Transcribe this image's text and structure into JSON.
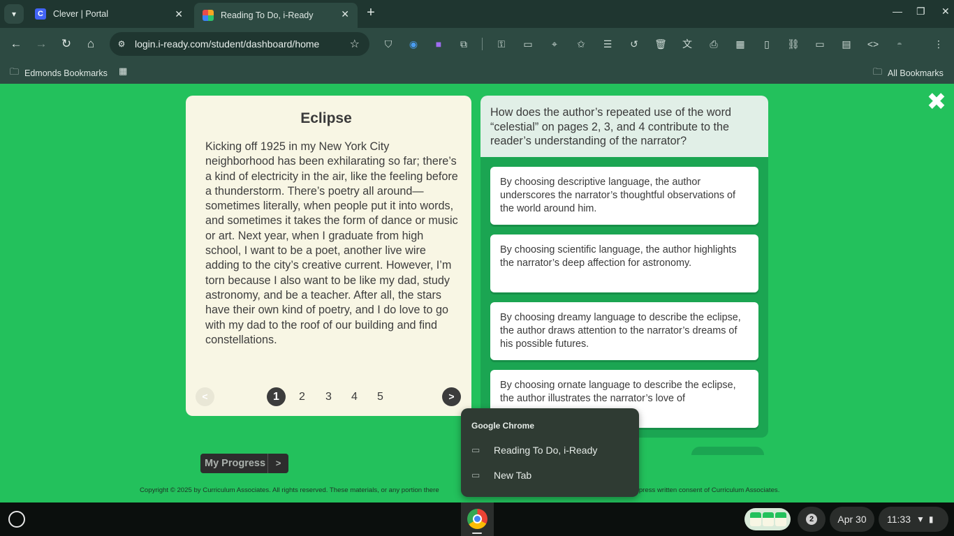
{
  "browser": {
    "tabs": [
      {
        "title": "Clever | Portal",
        "favicon": "clever-icon",
        "active": false
      },
      {
        "title": "Reading To Do, i-Ready",
        "favicon": "iready-icon",
        "active": true
      }
    ],
    "url": "login.i-ready.com/student/dashboard/home",
    "bookmarks": {
      "left": "Edmonds Bookmarks",
      "right": "All Bookmarks"
    }
  },
  "passage": {
    "title": "Eclipse",
    "text": "Kicking off 1925 in my New York City neighborhood has been exhilarating so far; there’s a kind of electricity in the air, like the feeling before a thunderstorm. There’s poetry all around—sometimes literally, when people put it into words, and sometimes it takes the form of dance or music or art. Next year, when I graduate from high school, I want to be a poet, another live wire adding to the city’s creative current. However, I’m torn because I also want to be like my dad, study astronomy, and be a teacher. After all, the stars have their own kind of poetry, and I do love to go with my dad to the roof of our building and find constellations.",
    "pages": [
      "1",
      "2",
      "3",
      "4",
      "5"
    ],
    "current_page": "1",
    "prev_label": "<",
    "next_label": ">"
  },
  "question": {
    "text": "How does the author’s repeated use of the word “celestial” on pages 2, 3, and 4 contribute to the reader’s understanding of the narrator?",
    "choices": [
      "By choosing descriptive language, the author underscores the narrator’s thoughtful observations of the world around him.",
      "By choosing scientific language, the author highlights the narrator’s deep affection for astronomy.",
      "By choosing dreamy language to describe the eclipse, the author draws attention to the narrator’s dreams of his possible futures.",
      "By choosing ornate language to describe the eclipse, the author illustrates the narrator’s love of"
    ]
  },
  "progress_button": {
    "label": "My Progress",
    "arrow": ">"
  },
  "copyright": "Copyright © 2025 by Curriculum Associates. All rights reserved. These materials, or any portion there",
  "copyright_tail": "thout express written consent of Curriculum Associates.",
  "popup": {
    "title": "Google Chrome",
    "items": [
      "Reading To Do, i-Ready",
      "New Tab"
    ]
  },
  "shelf": {
    "notification_count": "2",
    "date": "Apr 30",
    "time": "11:33"
  },
  "colors": {
    "page_bg": "#23c15c",
    "panel_green": "#1ba552",
    "passage_bg": "#f8f6e4"
  }
}
